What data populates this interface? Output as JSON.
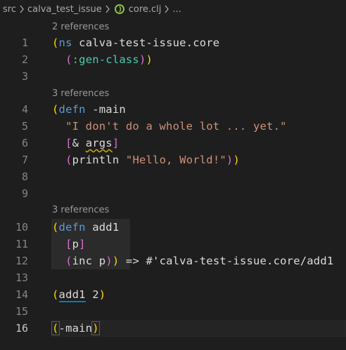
{
  "breadcrumb": {
    "items": [
      "src",
      "calva_test_issue",
      "core.clj",
      "..."
    ],
    "file_icon": "clojure-file-icon"
  },
  "code_lens": {
    "ns": "2 references",
    "main": "3 references",
    "add1": "3 references"
  },
  "lines": [
    {
      "num": "1"
    },
    {
      "num": "2"
    },
    {
      "num": "3"
    },
    {
      "num": "4"
    },
    {
      "num": "5"
    },
    {
      "num": "6"
    },
    {
      "num": "7"
    },
    {
      "num": "8"
    },
    {
      "num": "9"
    },
    {
      "num": "10"
    },
    {
      "num": "11"
    },
    {
      "num": "12"
    },
    {
      "num": "13"
    },
    {
      "num": "14"
    },
    {
      "num": "15"
    },
    {
      "num": "16"
    }
  ],
  "tokens": {
    "l1_open": "(",
    "l1_ns": "ns",
    "l1_name": " calva-test-issue.core",
    "l2_open": "(",
    "l2_kw": ":gen-class",
    "l2_close": ")",
    "l2_close2": ")",
    "l4_open": "(",
    "l4_defn": "defn",
    "l4_name": " -main",
    "l5_str": "\"I don't do a whole lot ... yet.\"",
    "l6_open": "[",
    "l6_amp": "& ",
    "l6_args": "args",
    "l6_close": "]",
    "l7_open": "(",
    "l7_fn": "println",
    "l7_str": "\"Hello, World!\"",
    "l7_close": ")",
    "l7_close2": ")",
    "l10_open": "(",
    "l10_defn": "defn",
    "l10_name": " add1",
    "l11_open": "[",
    "l11_p": "p",
    "l11_close": "]",
    "l12_open": "(",
    "l12_inc": "inc p",
    "l12_close": ")",
    "l12_close2": ")",
    "l12_result": " => #'calva-test-issue.core/add1",
    "l14_open": "(",
    "l14_fn": "add1",
    "l14_arg": " 2",
    "l14_close": ")",
    "l16_open": "(",
    "l16_fn": "-main",
    "l16_close": ")"
  },
  "colors": {
    "background": "#1e1e1e",
    "paren_level1": "#ffd700",
    "paren_level2": "#da70d6",
    "paren_level3": "#179fff",
    "string": "#ce9178",
    "keyword": "#569cd6"
  }
}
